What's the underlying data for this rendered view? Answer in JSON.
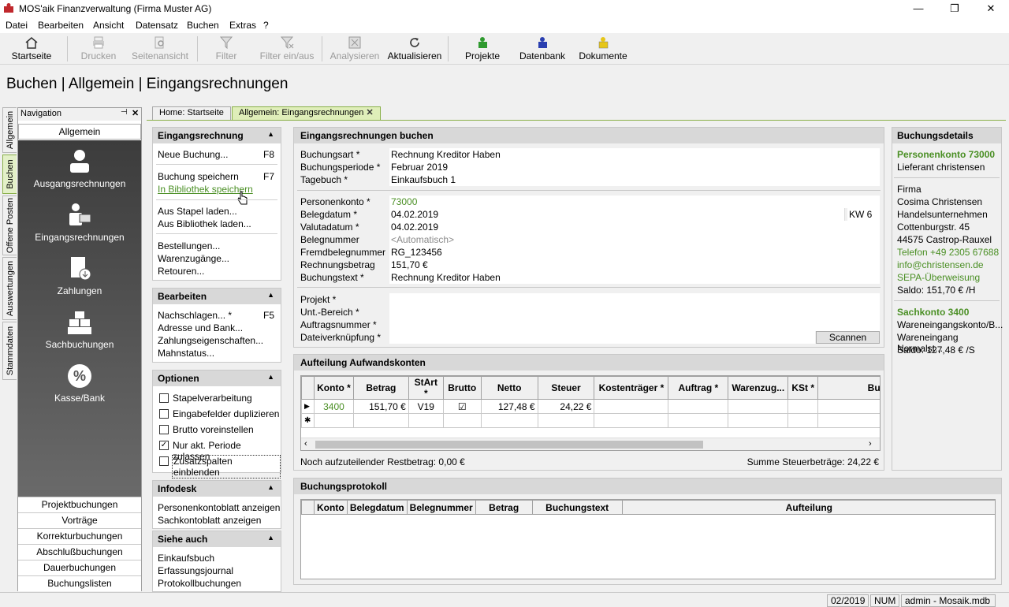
{
  "window": {
    "title": "MOS'aik Finanzverwaltung (Firma Muster AG)",
    "minimize": "—",
    "maximize": "❐",
    "close": "✕"
  },
  "menu": [
    "Datei",
    "Bearbeiten",
    "Ansicht",
    "Datensatz",
    "Buchen",
    "Extras",
    "?"
  ],
  "toolbar": {
    "startseite": "Startseite",
    "drucken": "Drucken",
    "seitenansicht": "Seitenansicht",
    "filter": "Filter",
    "filter_einaus": "Filter ein/aus",
    "analysieren": "Analysieren",
    "aktualisieren": "Aktualisieren",
    "projekte": "Projekte",
    "datenbank": "Datenbank",
    "dokumente": "Dokumente"
  },
  "page_title": "Buchen | Allgemein | Eingangsrechnungen",
  "vertical_tabs": [
    "Allgemein",
    "Buchen",
    "Offene Posten",
    "Auswertungen",
    "Stammdaten"
  ],
  "nav": {
    "title": "Navigation",
    "pin": "📌",
    "close": "✕",
    "section": "Allgemein",
    "big_items": [
      "Ausgangsrechnungen",
      "Eingangsrechnungen",
      "Zahlungen",
      "Sachbuchungen",
      "Kasse/Bank"
    ],
    "small_items": [
      "Projektbuchungen",
      "Vorträge",
      "Korrekturbuchungen",
      "Abschlußbuchungen",
      "Dauerbuchungen",
      "Buchungslisten"
    ]
  },
  "doc_tabs": {
    "home": "Home: Startseite",
    "active": "Allgemein: Eingangsrechnungen",
    "close": "✕"
  },
  "tasks": {
    "eingang": {
      "title": "Eingangsrechnung",
      "neue": "Neue Buchung...",
      "neue_key": "F8",
      "speichern": "Buchung speichern",
      "speichern_key": "F7",
      "bibliothek": "In Bibliothek speichern",
      "stapel": "Aus Stapel laden...",
      "bib_laden": "Aus Bibliothek laden...",
      "bestellungen": "Bestellungen...",
      "warenzugaenge": "Warenzugänge...",
      "retouren": "Retouren..."
    },
    "bearbeiten": {
      "title": "Bearbeiten",
      "nachschlagen": "Nachschlagen... *",
      "nachschlagen_key": "F5",
      "adresse": "Adresse und Bank...",
      "zahlung": "Zahlungseigenschaften...",
      "mahnstatus": "Mahnstatus..."
    },
    "optionen": {
      "title": "Optionen",
      "opt": [
        {
          "label": "Stapelverarbeitung",
          "checked": ""
        },
        {
          "label": "Eingabefelder duplizieren",
          "checked": ""
        },
        {
          "label": "Brutto voreinstellen",
          "checked": ""
        },
        {
          "label": "Nur akt. Periode zulassen",
          "checked": "✓"
        },
        {
          "label": "Zusatzspalten einblenden",
          "checked": ""
        }
      ]
    },
    "infodesk": {
      "title": "Infodesk",
      "personen": "Personenkontoblatt anzeigen",
      "sach": "Sachkontoblatt anzeigen"
    },
    "siehe": {
      "title": "Siehe auch",
      "einkaufsbuch": "Einkaufsbuch",
      "erfassung": "Erfassungsjournal",
      "protokoll": "Protokollbuchungen"
    }
  },
  "form": {
    "title": "Eingangsrechnungen buchen",
    "buchungsart_l": "Buchungsart *",
    "buchungsart": "Rechnung Kreditor Haben",
    "periode_l": "Buchungsperiode *",
    "periode": "Februar 2019",
    "tagebuch_l": "Tagebuch *",
    "tagebuch": "Einkaufsbuch 1",
    "personenkonto_l": "Personenkonto *",
    "personenkonto": "73000",
    "belegdatum_l": "Belegdatum *",
    "belegdatum": "04.02.2019",
    "kw": "KW 6",
    "valutadatum_l": "Valutadatum *",
    "valutadatum": "04.02.2019",
    "belegnummer_l": "Belegnummer",
    "belegnummer": "<Automatisch>",
    "fremdbeleg_l": "Fremdbelegnummer",
    "fremdbeleg": "RG_123456",
    "betrag_l": "Rechnungsbetrag",
    "betrag": "151,70 €",
    "text_l": "Buchungstext *",
    "text": "Rechnung Kreditor Haben",
    "projekt_l": "Projekt *",
    "bereich_l": "Unt.-Bereich *",
    "auftrag_l": "Auftragsnummer *",
    "datei_l": "Dateiverknüpfung *",
    "scannen": "Scannen"
  },
  "aufteilung": {
    "title": "Aufteilung Aufwandskonten",
    "columns": [
      "Konto *",
      "Betrag",
      "StArt *",
      "Brutto",
      "Netto",
      "Steuer",
      "Kostenträger *",
      "Auftrag *",
      "Warenzug...",
      "KSt *",
      "Buchu"
    ],
    "row": {
      "konto": "3400",
      "betrag": "151,70 €",
      "start": "V19",
      "brutto": "☑",
      "netto": "127,48 €",
      "steuer": "24,22 €"
    },
    "newrow": "✱",
    "rest": "Noch aufzuteilender Restbetrag: 0,00 €",
    "summe": "Summe Steuerbeträge: 24,22 €"
  },
  "protokoll": {
    "title": "Buchungsprotokoll",
    "columns": [
      "Konto",
      "Belegdatum",
      "Belegnummer",
      "Betrag",
      "Buchungstext",
      "Aufteilung"
    ]
  },
  "details": {
    "title": "Buchungsdetails",
    "personenkonto": "Personenkonto 73000",
    "lieferant": "Lieferant christensen",
    "firma": "Firma",
    "name": "Cosima Christensen",
    "typ": "Handelsunternehmen",
    "strasse": "Cottenburgstr. 45",
    "ort": "44575 Castrop-Rauxel",
    "telefon": "Telefon +49 2305 67688",
    "email": "info@christensen.de",
    "sepa": "SEPA-Überweisung",
    "saldo1": "Saldo: 151,70 € /H",
    "sachkonto": "Sachkonto 3400",
    "sach1": "Wareneingangskonto/B...",
    "sach2": "Wareneingang Normalst...",
    "saldo2": "Saldo: 127,48 € /S"
  },
  "status": {
    "periode": "02/2019",
    "num": "NUM",
    "user": "admin - Mosaik.mdb"
  }
}
